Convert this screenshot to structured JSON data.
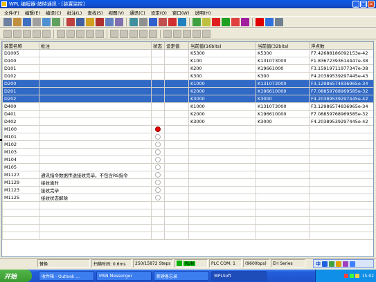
{
  "window": {
    "title": "WPL 编程器-諸時通訊 - [装置监控]"
  },
  "menu": [
    "文件(F)",
    "编辑(E)",
    "编译(C)",
    "批注(L)",
    "查找(S)",
    "视图(V)",
    "通讯(C)",
    "设定(O)",
    "窗口(W)",
    "说明(H)"
  ],
  "toolbar1_icons": [
    "new",
    "open",
    "save",
    "print",
    "undo",
    "redo",
    "cut",
    "copy",
    "paste",
    "delete",
    "find",
    "replace",
    "find-next",
    "zoom",
    "help",
    "monitor",
    "ladder",
    "list",
    "table",
    "comment",
    "device",
    "run",
    "stop",
    "reset",
    "plc",
    "plc2",
    "monitor2"
  ],
  "toolbar2_icons": [
    "t1",
    "t2",
    "t3",
    "t4",
    "t5",
    "t6",
    "t7",
    "t8",
    "t9",
    "t10",
    "t11",
    "t12",
    "t13",
    "t14",
    "t15",
    "t16",
    "t17",
    "t18",
    "t19",
    "t20"
  ],
  "table": {
    "headers": [
      "装置名称",
      "批注",
      "状态",
      "设定值",
      "当前值(16bits)",
      "当前值(32bits)",
      "浮点数"
    ],
    "rows": [
      {
        "name": "D1005",
        "comment": "",
        "status": "",
        "setv": "",
        "v16": "K5300",
        "v32": "K5300",
        "flt": "F7.42688186092153e-42",
        "sel": false
      },
      {
        "name": "D100",
        "comment": "",
        "status": "",
        "setv": "",
        "v16": "K100",
        "v32": "K131073000",
        "flt": "F1.83672393614447e-38",
        "sel": false
      },
      {
        "name": "D101",
        "comment": "",
        "status": "",
        "setv": "",
        "v16": "K200",
        "v32": "K19661000",
        "flt": "F3.15919711977347e-38",
        "sel": false
      },
      {
        "name": "D102",
        "comment": "",
        "status": "",
        "setv": "",
        "v16": "K300",
        "v32": "K300",
        "flt": "F4.20389539297445e-43",
        "sel": false
      },
      {
        "name": "D200",
        "comment": "",
        "status": "",
        "setv": "",
        "v16": "K1000",
        "v32": "K131073000",
        "flt": "F3.12986574836965e-34",
        "sel": true
      },
      {
        "name": "D201",
        "comment": "",
        "status": "",
        "setv": "",
        "v16": "K2000",
        "v32": "K196610000",
        "flt": "F7.08859768969585e-32",
        "sel": true
      },
      {
        "name": "D202",
        "comment": "",
        "status": "",
        "setv": "",
        "v16": "K3000",
        "v32": "K3000",
        "flt": "F4.20389539297445e-42",
        "sel": true
      },
      {
        "name": "D400",
        "comment": "",
        "status": "",
        "setv": "",
        "v16": "K1000",
        "v32": "K131073000",
        "flt": "F3.12986574836965e-34",
        "sel": false
      },
      {
        "name": "D401",
        "comment": "",
        "status": "",
        "setv": "",
        "v16": "K2000",
        "v32": "K196610000",
        "flt": "F7.08859768969585e-32",
        "sel": false
      },
      {
        "name": "D402",
        "comment": "",
        "status": "",
        "setv": "",
        "v16": "K3000",
        "v32": "K3000",
        "flt": "F4.20389539297445e-42",
        "sel": false
      },
      {
        "name": "M100",
        "comment": "",
        "status": "on",
        "setv": "",
        "v16": "",
        "v32": "",
        "flt": "",
        "sel": false
      },
      {
        "name": "M101",
        "comment": "",
        "status": "off",
        "setv": "",
        "v16": "",
        "v32": "",
        "flt": "",
        "sel": false
      },
      {
        "name": "M102",
        "comment": "",
        "status": "off",
        "setv": "",
        "v16": "",
        "v32": "",
        "flt": "",
        "sel": false
      },
      {
        "name": "M103",
        "comment": "",
        "status": "off",
        "setv": "",
        "v16": "",
        "v32": "",
        "flt": "",
        "sel": false
      },
      {
        "name": "M104",
        "comment": "",
        "status": "off",
        "setv": "",
        "v16": "",
        "v32": "",
        "flt": "",
        "sel": false
      },
      {
        "name": "M105",
        "comment": "",
        "status": "off",
        "setv": "",
        "v16": "",
        "v32": "",
        "flt": "",
        "sel": false
      },
      {
        "name": "M1127",
        "comment": "通讯指令数据传送接收完毕，不包含RS指令",
        "status": "off",
        "setv": "",
        "v16": "",
        "v32": "",
        "flt": "",
        "sel": false
      },
      {
        "name": "M1129",
        "comment": "接收逾时",
        "status": "off",
        "setv": "",
        "v16": "",
        "v32": "",
        "flt": "",
        "sel": false
      },
      {
        "name": "M1123",
        "comment": "接收完毕",
        "status": "off",
        "setv": "",
        "v16": "",
        "v32": "",
        "flt": "",
        "sel": false
      },
      {
        "name": "M1125",
        "comment": "接收状态解除",
        "status": "off",
        "setv": "",
        "v16": "",
        "v32": "",
        "flt": "",
        "sel": false
      }
    ]
  },
  "statusbar": {
    "mode": "替换",
    "scan": "扫描时间: 0.6ms",
    "steps": "250/15872 Steps",
    "run": "RUN",
    "comm": "PLC COM: 1",
    "baud": "(9600bps)",
    "series": "EH Series"
  },
  "taskbar": {
    "start": "开始",
    "tasks": [
      "收件箱 - Outlook ...",
      "MSN Messenger",
      "新建备忘录",
      "WPLSoft"
    ],
    "clock": "15:02"
  },
  "colors": {
    "selection": "#3169c6",
    "title": "#0a5ae6",
    "run": "#00b000",
    "status_on": "#e00000"
  }
}
